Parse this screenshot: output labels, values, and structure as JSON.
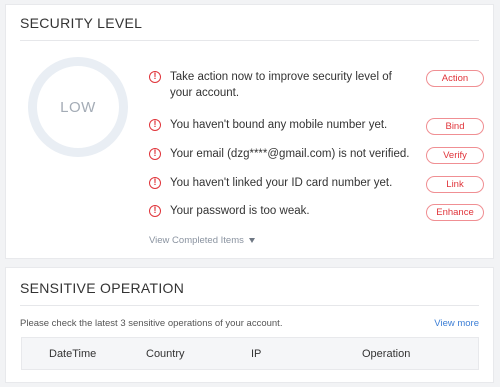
{
  "security": {
    "title": "SECURITY LEVEL",
    "level_label": "LOW",
    "issues": [
      {
        "text": "Take action now to improve security level of your account.",
        "button": "Action"
      },
      {
        "text": "You haven't bound any mobile number yet.",
        "button": "Bind"
      },
      {
        "text": "Your email (dzg****@gmail.com) is not verified.",
        "button": "Verify"
      },
      {
        "text": "You haven't linked your ID card number yet.",
        "button": "Link"
      },
      {
        "text": "Your password is too weak.",
        "button": "Enhance"
      }
    ],
    "warn_icon_glyph": "!",
    "view_completed_label": "View Completed Items"
  },
  "sensitive": {
    "title": "SENSITIVE OPERATION",
    "description": "Please check the latest 3 sensitive operations of your account.",
    "view_more_label": "View more",
    "columns": [
      "DateTime",
      "Country",
      "IP",
      "Operation"
    ]
  },
  "colors": {
    "warning_red": "#e0343a",
    "link_blue": "#3d7fd6",
    "ring_gray": "#e9eef4"
  }
}
